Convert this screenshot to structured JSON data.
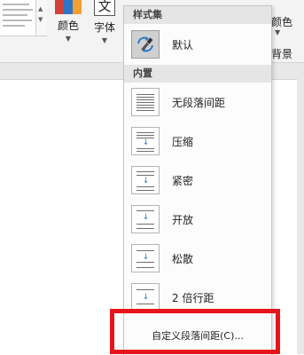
{
  "ribbon": {
    "color_label": "颜色",
    "font_label": "字体",
    "font_icon_char": "文",
    "right_color_label": "颜色",
    "page_background_label": "页面背景"
  },
  "menu": {
    "section_style_set": "样式集",
    "default_label": "默认",
    "section_builtin": "内置",
    "items": [
      {
        "label": "无段落间距"
      },
      {
        "label": "压缩"
      },
      {
        "label": "紧密"
      },
      {
        "label": "开放"
      },
      {
        "label": "松散"
      },
      {
        "label": "2 倍行距"
      }
    ],
    "custom_label": "自定义段落间距(C)..."
  },
  "colors": {
    "highlight_border": "#e8141c",
    "arrow_blue": "#2b79d0"
  },
  "icons": [
    "paintbrush-icon",
    "no-spacing-icon",
    "compact-spacing-icon",
    "tight-spacing-icon",
    "open-spacing-icon",
    "relaxed-spacing-icon",
    "double-spacing-icon"
  ]
}
